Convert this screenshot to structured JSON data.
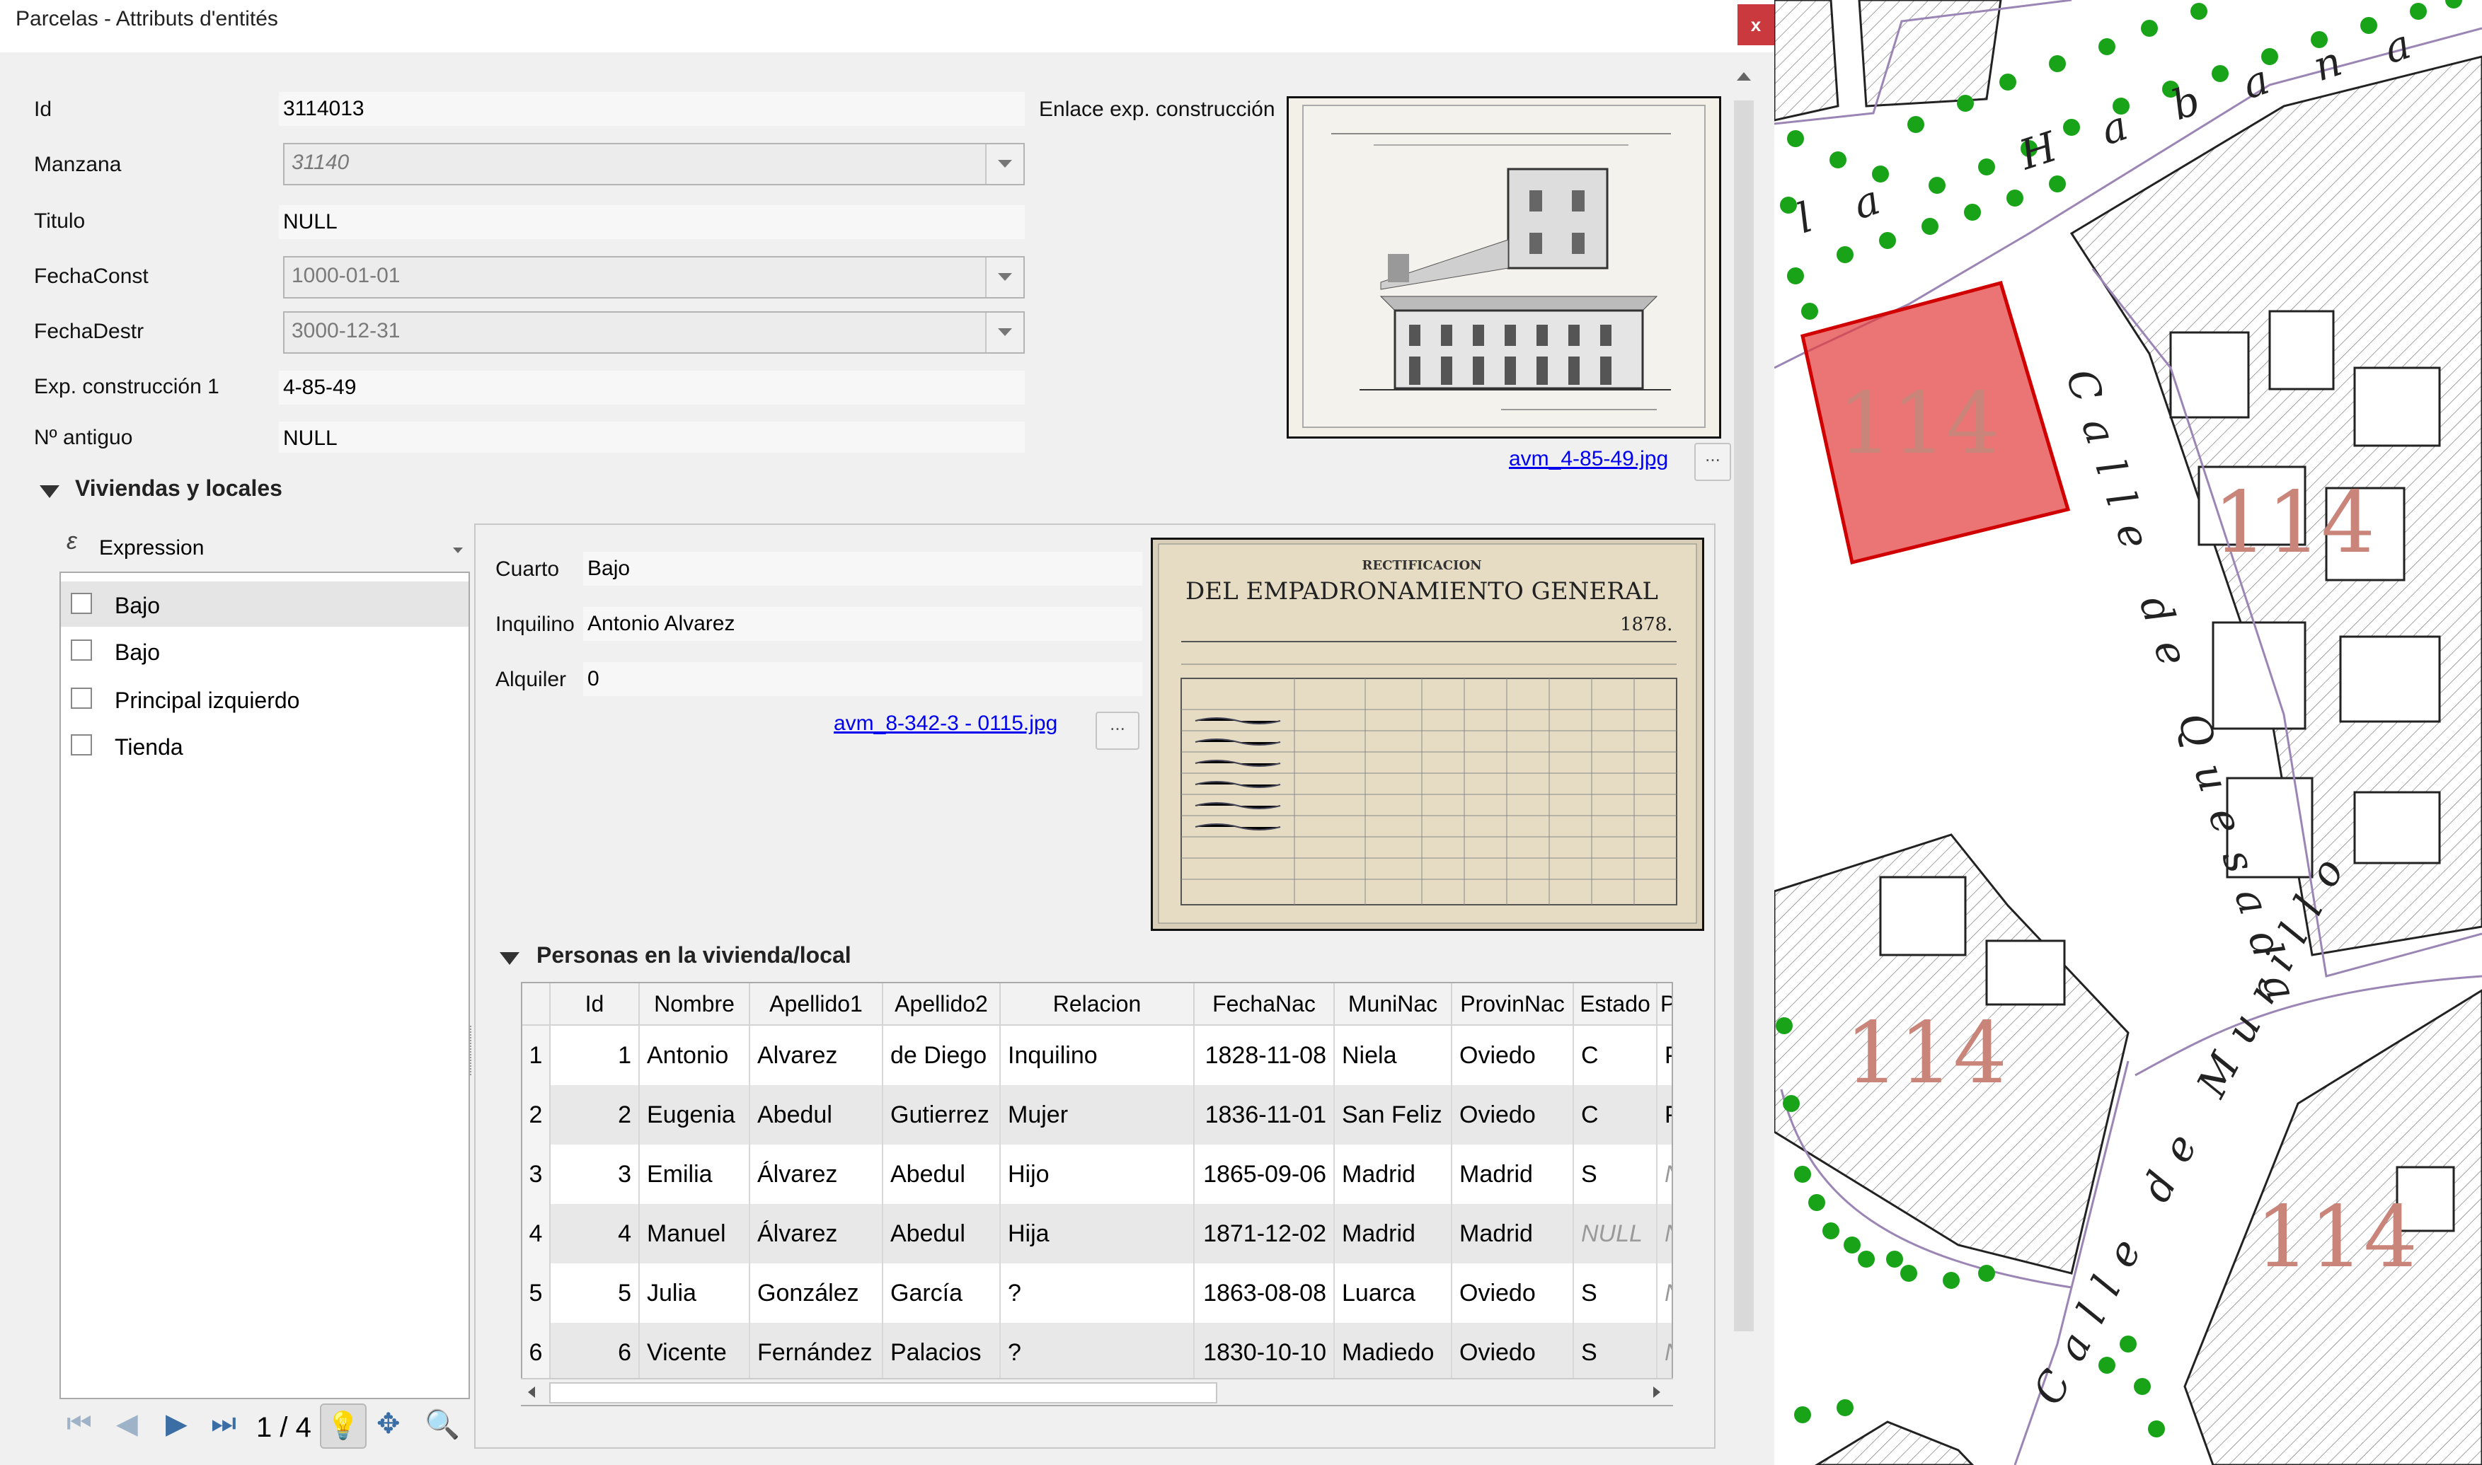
{
  "window": {
    "title": "Parcelas - Attributs d'entités",
    "close_label": "x"
  },
  "fields": [
    {
      "label": "Id",
      "value": "3114013",
      "type": "text"
    },
    {
      "label": "Manzana",
      "value": "31140",
      "type": "combo"
    },
    {
      "label": "Titulo",
      "value": "NULL",
      "type": "text"
    },
    {
      "label": "FechaConst",
      "value": "1000-01-01",
      "type": "combo"
    },
    {
      "label": "FechaDestr",
      "value": "3000-12-31",
      "type": "combo"
    },
    {
      "label": "Exp. construcción 1",
      "value": "4-85-49",
      "type": "text"
    },
    {
      "label": "Nº antiguo",
      "value": "NULL",
      "type": "text"
    }
  ],
  "enlace": {
    "label": "Enlace exp. construcción",
    "link": "avm_4-85-49.jpg",
    "button": "..."
  },
  "viviendas": {
    "title": "Viviendas y locales",
    "expression_label": "Expression",
    "items": [
      "Bajo",
      "Bajo",
      "Principal izquierdo",
      "Tienda"
    ],
    "nav_counter": "1 / 4"
  },
  "detail": {
    "cuarto_label": "Cuarto",
    "cuarto": "Bajo",
    "inquilino_label": "Inquilino",
    "inquilino": "Antonio Alvarez",
    "alquiler_label": "Alquiler",
    "alquiler": "0",
    "link": "avm_8-342-3 - 0115.jpg",
    "button": "..."
  },
  "personas": {
    "title": "Personas en la vivienda/local",
    "columns": [
      "Id",
      "Nombre",
      "Apellido1",
      "Apellido2",
      "Relacion",
      "FechaNac",
      "MuniNac",
      "ProvinNac",
      "Estado",
      "Pr"
    ],
    "rows": [
      [
        "1",
        "1",
        "Antonio",
        "Alvarez",
        "de Diego",
        "Inquilino",
        "1828-11-08",
        "Niela",
        "Oviedo",
        "C",
        "Pro"
      ],
      [
        "2",
        "2",
        "Eugenia",
        "Abedul",
        "Gutierrez",
        "Mujer",
        "1836-11-01",
        "San Feliz",
        "Oviedo",
        "C",
        "Pro"
      ],
      [
        "3",
        "3",
        "Emilia",
        "Álvarez",
        "Abedul",
        "Hijo",
        "1865-09-06",
        "Madrid",
        "Madrid",
        "S",
        "NU"
      ],
      [
        "4",
        "4",
        "Manuel",
        "Álvarez",
        "Abedul",
        "Hija",
        "1871-12-02",
        "Madrid",
        "Madrid",
        "NULL",
        "NU"
      ],
      [
        "5",
        "5",
        "Julia",
        "González",
        "García",
        "?",
        "1863-08-08",
        "Luarca",
        "Oviedo",
        "S",
        "NU"
      ],
      [
        "6",
        "6",
        "Vicente",
        "Fernández",
        "Palacios",
        "?",
        "1830-10-10",
        "Madiedo",
        "Oviedo",
        "S",
        "NU"
      ]
    ]
  },
  "document_heading": {
    "line1": "RECTIFICACION",
    "line2": "DEL EMPADRONAMIENTO GENERAL",
    "year": "1878."
  },
  "map": {
    "streets": [
      {
        "name": "la Habana",
        "letters": [
          "l",
          "a",
          "H",
          "a",
          "b",
          "a",
          "n",
          "a"
        ]
      },
      {
        "name": "Calle de Quesada"
      },
      {
        "name": "Calle de Murillo"
      }
    ],
    "block_labels": [
      "114",
      "114",
      "114",
      "114"
    ],
    "highlight_color": "#e23b3b"
  }
}
